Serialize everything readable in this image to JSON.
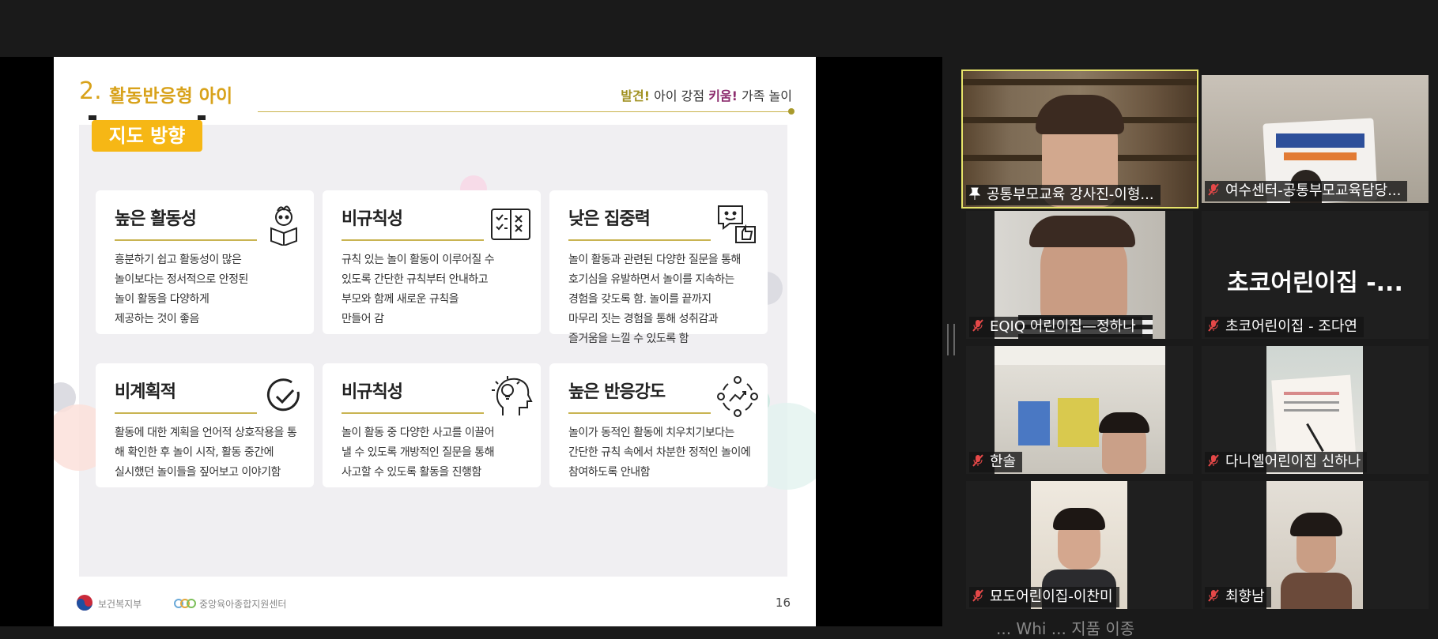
{
  "slide": {
    "section_number": "2.",
    "section_title": "활동반응형 아이",
    "subtitle_parts": [
      "발견!",
      " 아이 강점 ",
      "키움!",
      " 가족 놀이"
    ],
    "tab_label": "지도 방향",
    "cards": [
      {
        "title": "높은 활동성",
        "icon": "child-reading-icon",
        "lines": [
          "흥분하기 쉽고 활동성이 많은",
          "놀이보다는 정서적으로 안정된",
          "놀이 활동을 다양하게",
          "제공하는 것이 좋음"
        ]
      },
      {
        "title": "비규칙성",
        "icon": "checklist-book-icon",
        "lines": [
          "규칙 있는 놀이 활동이 이루어질 수",
          "있도록 간단한 규칙부터 안내하고",
          "부모와 함께 새로운 규칙을",
          "만들어 감"
        ]
      },
      {
        "title": "낮은 집중력",
        "icon": "chat-thumbs-up-icon",
        "lines": [
          "놀이 활동과 관련된 다양한 질문을 통해",
          "호기심을 유발하면서 놀이를 지속하는",
          "경험을 갖도록 함. 놀이를 끝까지",
          "마무리 짓는 경험을 통해 성취감과",
          "즐거움을 느낄 수 있도록 함"
        ]
      },
      {
        "title": "비계획적",
        "icon": "check-circle-icon",
        "lines": [
          "활동에 대한 계획을 언어적 상호작용을 통",
          "해 확인한 후 놀이 시작, 활동 중간에",
          "실시했던 놀이들을 짚어보고 이야기함"
        ]
      },
      {
        "title": "비규칙성",
        "icon": "head-lightbulb-icon",
        "lines": [
          "놀이 활동 중 다양한 사고를 이끌어",
          "낼 수 있도록 개방적인 질문을 통해",
          "사고할 수 있도록 활동을 진행함"
        ]
      },
      {
        "title": "높은 반응강도",
        "icon": "network-cycle-icon",
        "lines": [
          "놀이가 동적인 활동에 치우치기보다는",
          "간단한 규칙 속에서 차분한 정적인 놀이에",
          "참여하도록 안내함"
        ]
      }
    ],
    "footer": {
      "ministry": "보건복지부",
      "center": "중앙육아종합지원센터",
      "page": "16"
    },
    "colors": {
      "accent": "#d8a21a",
      "tab": "#f6b715",
      "highlight": "#8d2d6e",
      "panel": "#f0eff2"
    }
  },
  "participants": [
    {
      "name": "공통부모교육 강사진-이형...",
      "muted": false,
      "pinned": true,
      "active": true,
      "video": true
    },
    {
      "name": "여수센터-공통부모교육담당...",
      "muted": true,
      "video": true
    },
    {
      "name": "EQIQ 어린이집—정하나",
      "muted": true,
      "video": true
    },
    {
      "name": "초코어린이집 - 조다연",
      "muted": true,
      "video": false,
      "display_name": "초코어린이집 -..."
    },
    {
      "name": "한솔",
      "muted": true,
      "video": true
    },
    {
      "name": "다니엘어린이집 신하나",
      "muted": true,
      "video": true
    },
    {
      "name": "묘도어린이집-이찬미",
      "muted": true,
      "video": true
    },
    {
      "name": "최향남",
      "muted": true,
      "video": true
    }
  ],
  "bottom_partial_text": "...  Whi ...  지품 이종"
}
